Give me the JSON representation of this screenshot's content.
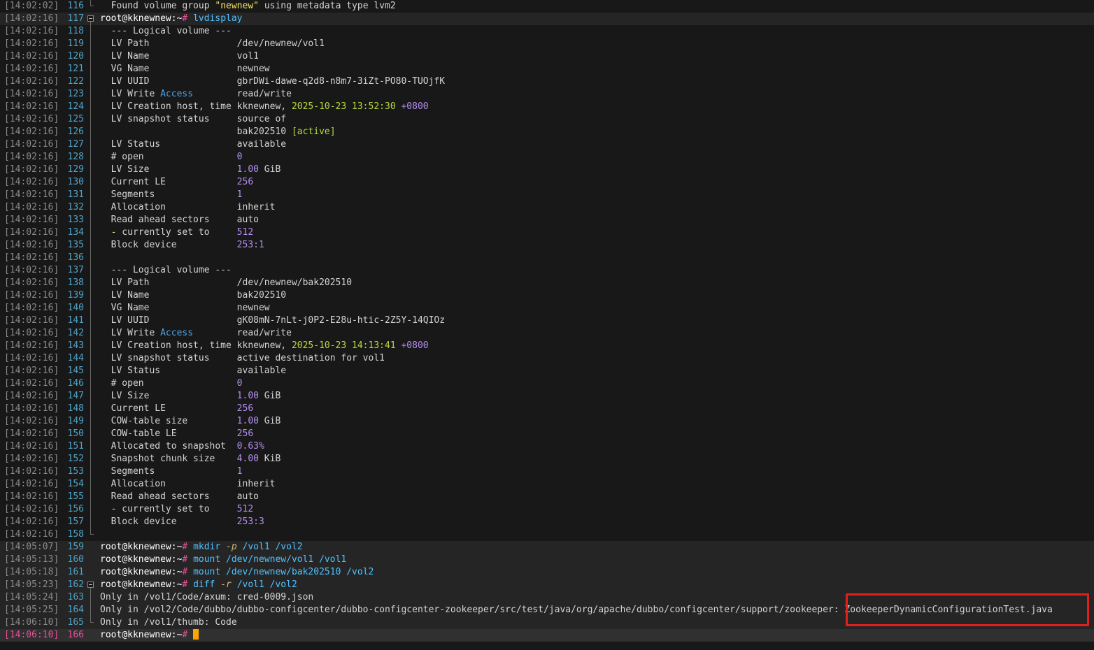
{
  "terminal": {
    "lines": [
      {
        "ts": "[14:02:02]",
        "ln": "116",
        "text": "  Found volume group \"newnew\" using metadata type lvm2"
      },
      {
        "ts": "[14:02:16]",
        "ln": "117",
        "text": "root@kknewnew:~# lvdisplay"
      },
      {
        "ts": "[14:02:16]",
        "ln": "118",
        "text": "  --- Logical volume ---"
      },
      {
        "ts": "[14:02:16]",
        "ln": "119",
        "text": "  LV Path                /dev/newnew/vol1"
      },
      {
        "ts": "[14:02:16]",
        "ln": "120",
        "text": "  LV Name                vol1"
      },
      {
        "ts": "[14:02:16]",
        "ln": "121",
        "text": "  VG Name                newnew"
      },
      {
        "ts": "[14:02:16]",
        "ln": "122",
        "text": "  LV UUID                gbrDWi-dawe-q2d8-n8m7-3iZt-PO80-TUOjfK"
      },
      {
        "ts": "[14:02:16]",
        "ln": "123",
        "text": "  LV Write Access        read/write"
      },
      {
        "ts": "[14:02:16]",
        "ln": "124",
        "text": "  LV Creation host, time kknewnew, 2025-10-23 13:52:30 +0800"
      },
      {
        "ts": "[14:02:16]",
        "ln": "125",
        "text": "  LV snapshot status     source of"
      },
      {
        "ts": "[14:02:16]",
        "ln": "126",
        "text": "                         bak202510 [active]"
      },
      {
        "ts": "[14:02:16]",
        "ln": "127",
        "text": "  LV Status              available"
      },
      {
        "ts": "[14:02:16]",
        "ln": "128",
        "text": "  # open                 0"
      },
      {
        "ts": "[14:02:16]",
        "ln": "129",
        "text": "  LV Size                1.00 GiB"
      },
      {
        "ts": "[14:02:16]",
        "ln": "130",
        "text": "  Current LE             256"
      },
      {
        "ts": "[14:02:16]",
        "ln": "131",
        "text": "  Segments               1"
      },
      {
        "ts": "[14:02:16]",
        "ln": "132",
        "text": "  Allocation             inherit"
      },
      {
        "ts": "[14:02:16]",
        "ln": "133",
        "text": "  Read ahead sectors     auto"
      },
      {
        "ts": "[14:02:16]",
        "ln": "134",
        "text": "  - currently set to     512"
      },
      {
        "ts": "[14:02:16]",
        "ln": "135",
        "text": "  Block device           253:1"
      },
      {
        "ts": "[14:02:16]",
        "ln": "136",
        "text": ""
      },
      {
        "ts": "[14:02:16]",
        "ln": "137",
        "text": "  --- Logical volume ---"
      },
      {
        "ts": "[14:02:16]",
        "ln": "138",
        "text": "  LV Path                /dev/newnew/bak202510"
      },
      {
        "ts": "[14:02:16]",
        "ln": "139",
        "text": "  LV Name                bak202510"
      },
      {
        "ts": "[14:02:16]",
        "ln": "140",
        "text": "  VG Name                newnew"
      },
      {
        "ts": "[14:02:16]",
        "ln": "141",
        "text": "  LV UUID                gK08mN-7nLt-j0P2-E28u-htic-2Z5Y-14QIOz"
      },
      {
        "ts": "[14:02:16]",
        "ln": "142",
        "text": "  LV Write Access        read/write"
      },
      {
        "ts": "[14:02:16]",
        "ln": "143",
        "text": "  LV Creation host, time kknewnew, 2025-10-23 14:13:41 +0800"
      },
      {
        "ts": "[14:02:16]",
        "ln": "144",
        "text": "  LV snapshot status     active destination for vol1"
      },
      {
        "ts": "[14:02:16]",
        "ln": "145",
        "text": "  LV Status              available"
      },
      {
        "ts": "[14:02:16]",
        "ln": "146",
        "text": "  # open                 0"
      },
      {
        "ts": "[14:02:16]",
        "ln": "147",
        "text": "  LV Size                1.00 GiB"
      },
      {
        "ts": "[14:02:16]",
        "ln": "148",
        "text": "  Current LE             256"
      },
      {
        "ts": "[14:02:16]",
        "ln": "149",
        "text": "  COW-table size         1.00 GiB"
      },
      {
        "ts": "[14:02:16]",
        "ln": "150",
        "text": "  COW-table LE           256"
      },
      {
        "ts": "[14:02:16]",
        "ln": "151",
        "text": "  Allocated to snapshot  0.63%"
      },
      {
        "ts": "[14:02:16]",
        "ln": "152",
        "text": "  Snapshot chunk size    4.00 KiB"
      },
      {
        "ts": "[14:02:16]",
        "ln": "153",
        "text": "  Segments               1"
      },
      {
        "ts": "[14:02:16]",
        "ln": "154",
        "text": "  Allocation             inherit"
      },
      {
        "ts": "[14:02:16]",
        "ln": "155",
        "text": "  Read ahead sectors     auto"
      },
      {
        "ts": "[14:02:16]",
        "ln": "156",
        "text": "  - currently set to     512"
      },
      {
        "ts": "[14:02:16]",
        "ln": "157",
        "text": "  Block device           253:3"
      },
      {
        "ts": "[14:02:16]",
        "ln": "158",
        "text": ""
      },
      {
        "ts": "[14:05:07]",
        "ln": "159",
        "text": "root@kknewnew:~# mkdir -p /vol1 /vol2"
      },
      {
        "ts": "[14:05:13]",
        "ln": "160",
        "text": "root@kknewnew:~# mount /dev/newnew/vol1 /vol1"
      },
      {
        "ts": "[14:05:18]",
        "ln": "161",
        "text": "root@kknewnew:~# mount /dev/newnew/bak202510 /vol2"
      },
      {
        "ts": "[14:05:23]",
        "ln": "162",
        "text": "root@kknewnew:~# diff -r /vol1 /vol2"
      },
      {
        "ts": "[14:05:24]",
        "ln": "163",
        "text": "Only in /vol1/Code/axum: cred-0009.json"
      },
      {
        "ts": "[14:05:25]",
        "ln": "164",
        "text": "Only in /vol2/Code/dubbo/dubbo-configcenter/dubbo-configcenter-zookeeper/src/test/java/org/apache/dubbo/configcenter/support/zookeeper: ZookeeperDynamicConfigurationTest.java"
      },
      {
        "ts": "[14:06:10]",
        "ln": "165",
        "text": "Only in /vol1/thumb: Code"
      },
      {
        "ts": "[14:06:10]",
        "ln": "166",
        "text": "root@kknewnew:~# "
      }
    ]
  },
  "colors": {
    "background": "#181818",
    "cursor": "#ffa500",
    "highlight_box": "#e0201c"
  }
}
